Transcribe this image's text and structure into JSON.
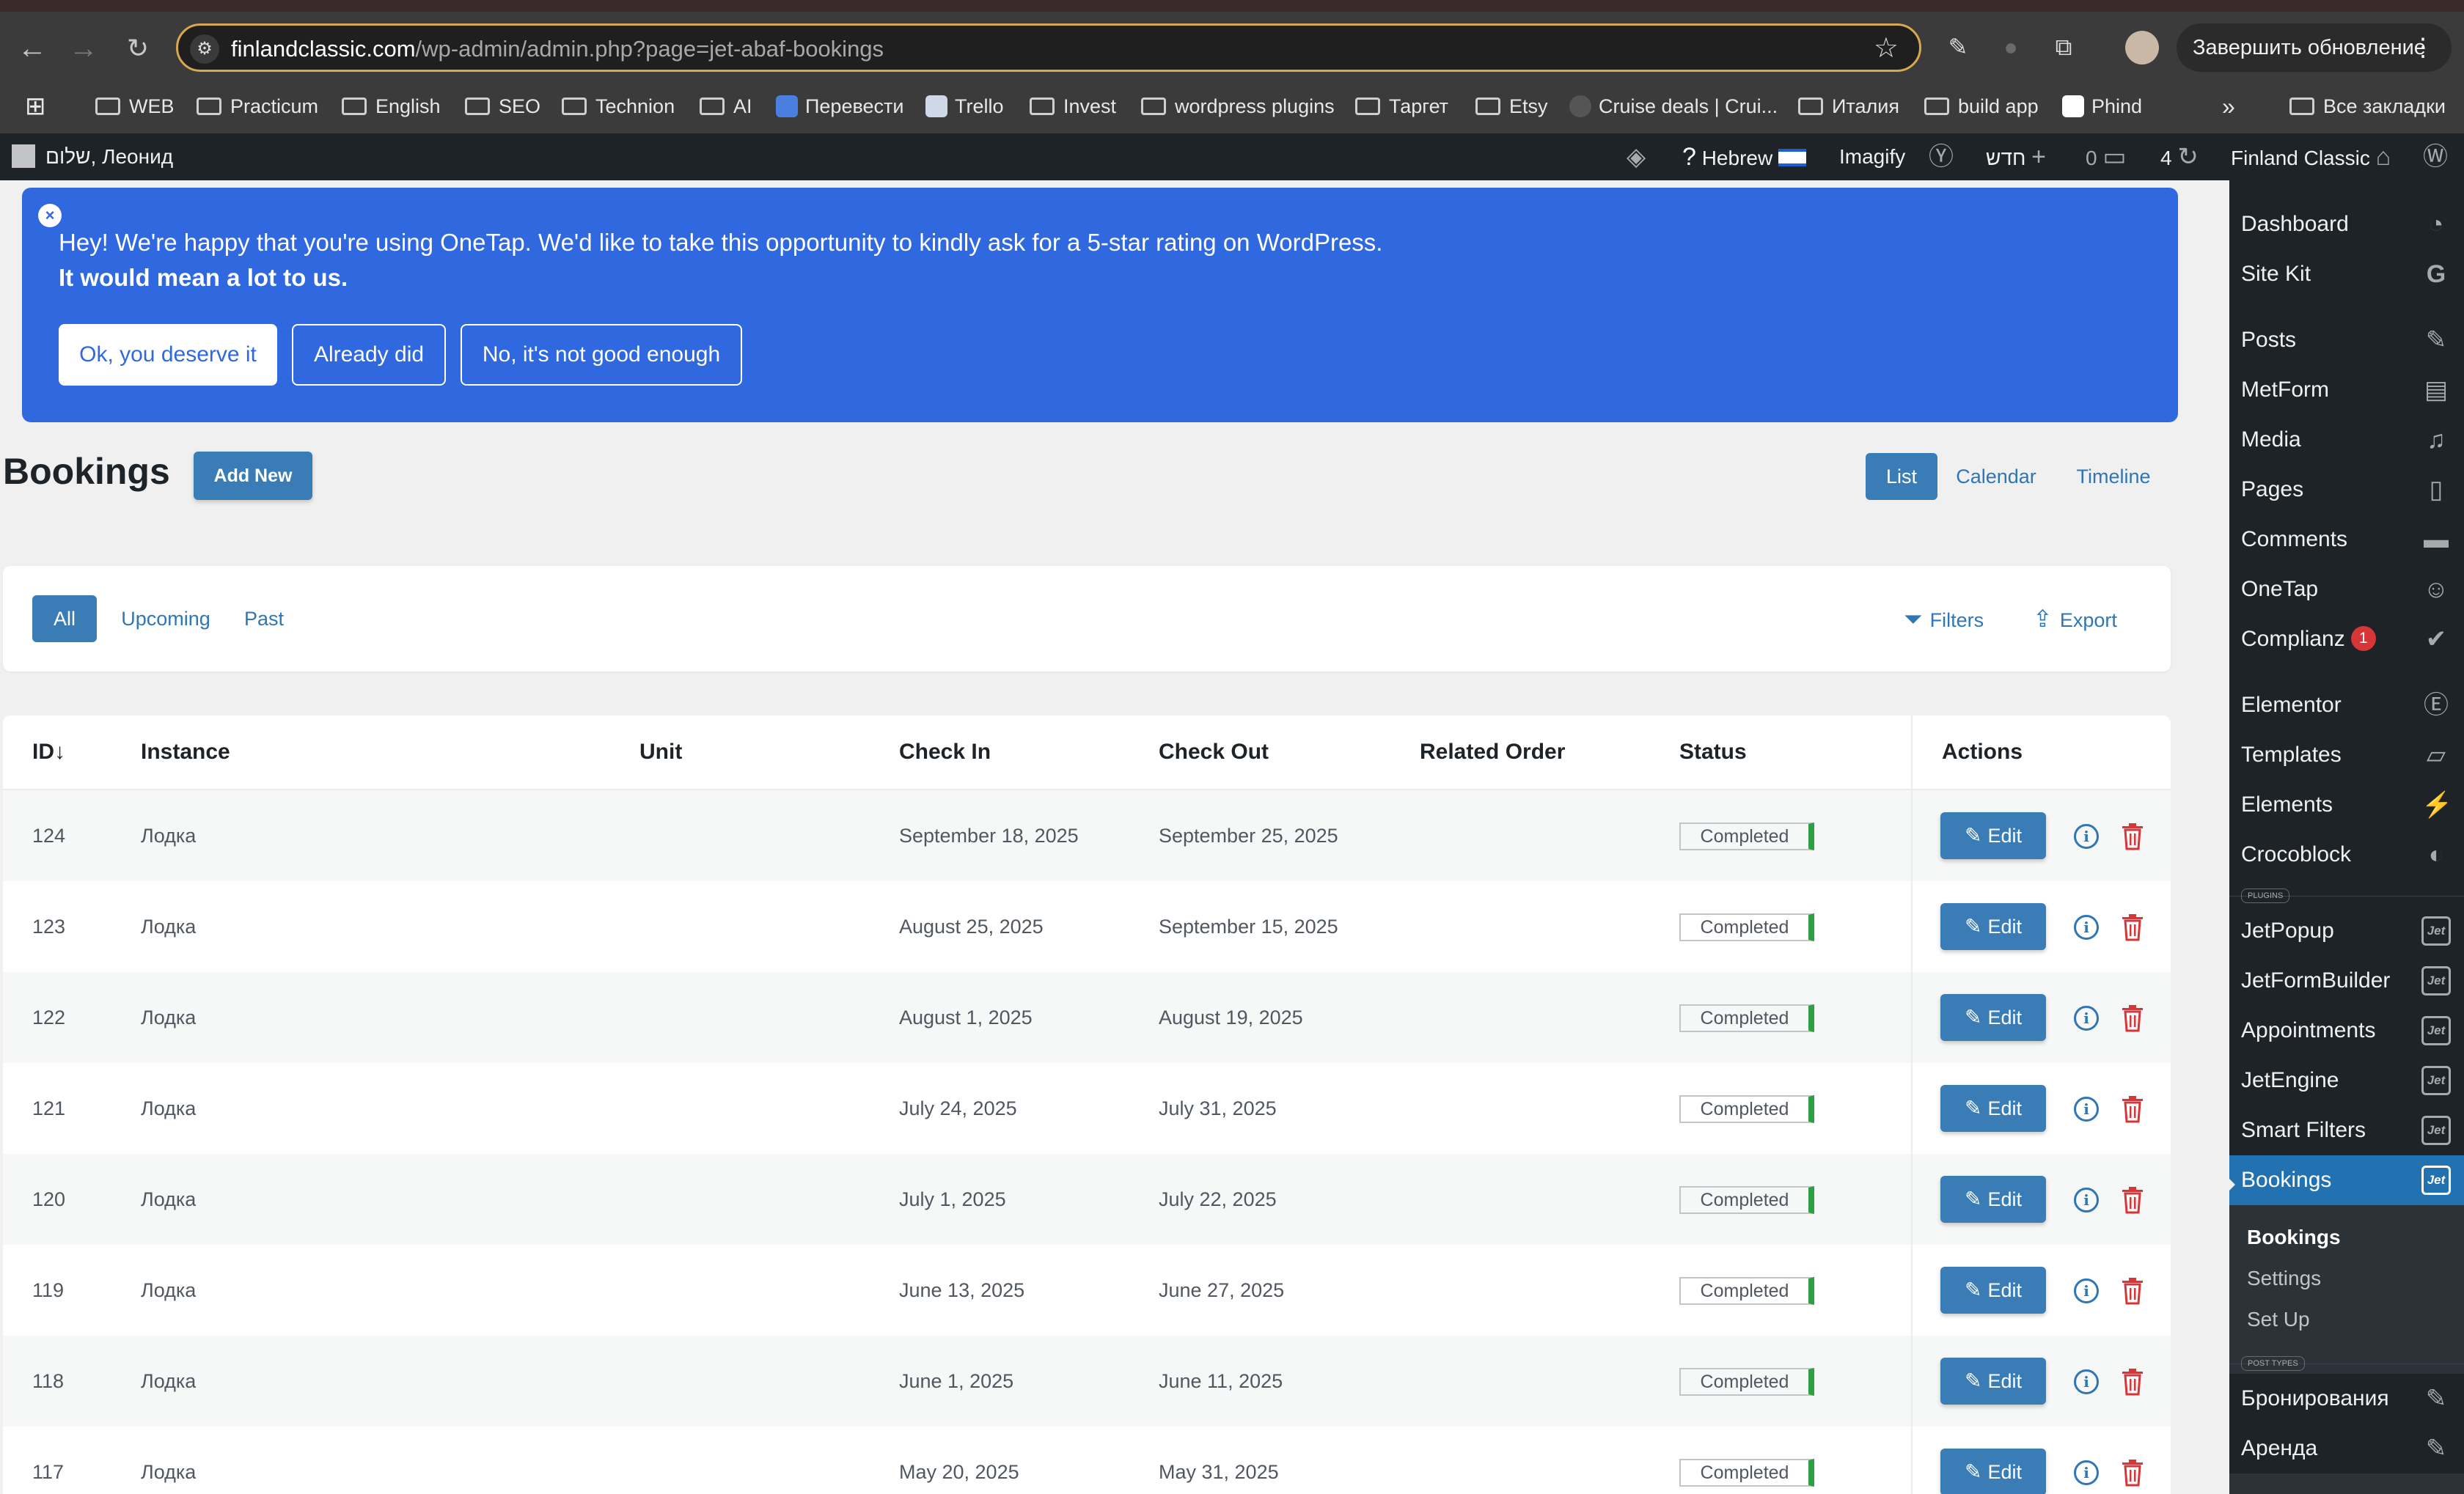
{
  "browser": {
    "url_host": "finlandclassic.com",
    "url_path": "/wp-admin/admin.php?page=jet-abaf-bookings",
    "update_label": "Завершить обновление",
    "bookmarks": [
      {
        "label": "WEB",
        "type": "folder"
      },
      {
        "label": "Practicum",
        "type": "folder"
      },
      {
        "label": "English",
        "type": "folder"
      },
      {
        "label": "SEO",
        "type": "folder"
      },
      {
        "label": "Technion",
        "type": "folder"
      },
      {
        "label": "AI",
        "type": "folder"
      },
      {
        "label": "Перевести",
        "type": "link"
      },
      {
        "label": "Trello",
        "type": "link"
      },
      {
        "label": "Invest",
        "type": "folder"
      },
      {
        "label": "wordpress plugins",
        "type": "folder"
      },
      {
        "label": "Таргет",
        "type": "folder"
      },
      {
        "label": "Etsy",
        "type": "folder"
      },
      {
        "label": "Cruise deals | Crui...",
        "type": "link"
      },
      {
        "label": "Италия",
        "type": "folder"
      },
      {
        "label": "build app",
        "type": "folder"
      },
      {
        "label": "Phind",
        "type": "link"
      }
    ],
    "more_label": "»",
    "all_bookmarks_label": "Все закладки"
  },
  "admin_bar": {
    "greeting": "שלום, Леонид",
    "language": "Hebrew",
    "imagify": "Imagify",
    "new_label": "חדש",
    "comments_count": "0",
    "updates_count": "4",
    "site_name": "Finland Classic"
  },
  "sidebar": {
    "items": [
      {
        "label": "Dashboard",
        "icon": "dashboard-icon"
      },
      {
        "label": "Site Kit",
        "icon": "google-icon"
      },
      {
        "label": "Posts",
        "icon": "pin-icon"
      },
      {
        "label": "MetForm",
        "icon": "form-icon"
      },
      {
        "label": "Media",
        "icon": "media-icon"
      },
      {
        "label": "Pages",
        "icon": "pages-icon"
      },
      {
        "label": "Comments",
        "icon": "comment-icon"
      },
      {
        "label": "OneTap",
        "icon": "accessibility-icon"
      },
      {
        "label": "Complianz",
        "icon": "check-icon",
        "badge": "1"
      },
      {
        "label": "Elementor",
        "icon": "elementor-icon"
      },
      {
        "label": "Templates",
        "icon": "folder-icon"
      },
      {
        "label": "Elements",
        "icon": "bolt-icon"
      },
      {
        "label": "Crocoblock",
        "icon": "crocoblock-icon"
      }
    ],
    "plugins_label": "PLUGINS",
    "jet_items": [
      {
        "label": "JetPopup"
      },
      {
        "label": "JetFormBuilder"
      },
      {
        "label": "Appointments"
      },
      {
        "label": "JetEngine"
      },
      {
        "label": "Smart Filters"
      },
      {
        "label": "Bookings"
      }
    ],
    "jet_icon_text": "Jet",
    "submenu": [
      {
        "label": "Bookings"
      },
      {
        "label": "Settings"
      },
      {
        "label": "Set Up"
      }
    ],
    "post_types_label": "POST TYPES",
    "post_types": [
      {
        "label": "Бронирования"
      },
      {
        "label": "Аренда"
      }
    ]
  },
  "notice": {
    "close": "×",
    "line1": "Hey! We're happy that you're using OneTap. We'd like to take this opportunity to kindly ask for a 5-star rating on WordPress.",
    "line2": "It would mean a lot to us.",
    "btn_ok": "Ok, you deserve it",
    "btn_already": "Already did",
    "btn_no": "No, it's not good enough"
  },
  "page": {
    "title": "Bookings",
    "add_new": "Add New",
    "views": [
      "List",
      "Calendar",
      "Timeline"
    ],
    "filter_tabs": [
      "All",
      "Upcoming",
      "Past"
    ],
    "filters_label": "Filters",
    "export_label": "Export"
  },
  "table": {
    "columns": [
      "ID↓",
      "Instance",
      "Unit",
      "Check In",
      "Check Out",
      "Related Order",
      "Status",
      "Actions"
    ],
    "edit_label": "Edit",
    "info_label": "i",
    "rows": [
      {
        "id": "124",
        "instance": "Лодка",
        "unit": "",
        "check_in": "September 18, 2025",
        "check_out": "September 25, 2025",
        "order": "",
        "status": "Completed"
      },
      {
        "id": "123",
        "instance": "Лодка",
        "unit": "",
        "check_in": "August 25, 2025",
        "check_out": "September 15, 2025",
        "order": "",
        "status": "Completed"
      },
      {
        "id": "122",
        "instance": "Лодка",
        "unit": "",
        "check_in": "August 1, 2025",
        "check_out": "August 19, 2025",
        "order": "",
        "status": "Completed"
      },
      {
        "id": "121",
        "instance": "Лодка",
        "unit": "",
        "check_in": "July 24, 2025",
        "check_out": "July 31, 2025",
        "order": "",
        "status": "Completed"
      },
      {
        "id": "120",
        "instance": "Лодка",
        "unit": "",
        "check_in": "July 1, 2025",
        "check_out": "July 22, 2025",
        "order": "",
        "status": "Completed"
      },
      {
        "id": "119",
        "instance": "Лодка",
        "unit": "",
        "check_in": "June 13, 2025",
        "check_out": "June 27, 2025",
        "order": "",
        "status": "Completed"
      },
      {
        "id": "118",
        "instance": "Лодка",
        "unit": "",
        "check_in": "June 1, 2025",
        "check_out": "June 11, 2025",
        "order": "",
        "status": "Completed"
      },
      {
        "id": "117",
        "instance": "Лодка",
        "unit": "",
        "check_in": "May 20, 2025",
        "check_out": "May 31, 2025",
        "order": "",
        "status": "Completed"
      }
    ]
  },
  "colors": {
    "wp_blue": "#3a7db6",
    "notice_blue": "#3068e0",
    "admin_dark": "#1d2327",
    "status_green": "#2ea043",
    "delete_red": "#d63638"
  }
}
